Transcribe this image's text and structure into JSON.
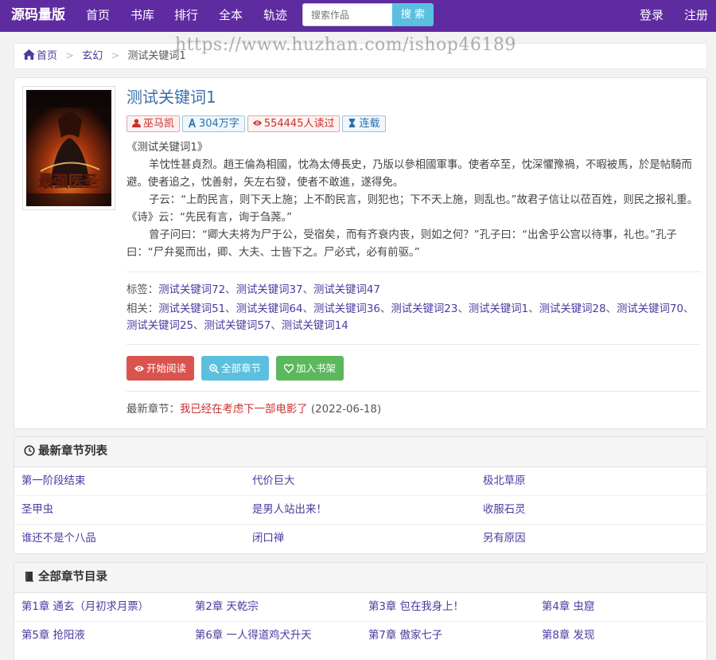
{
  "nav": {
    "brand": "源码量版",
    "links": [
      "首页",
      "书库",
      "排行",
      "全本",
      "轨迹"
    ],
    "search_placeholder": "搜索作品",
    "search_button": "搜 索",
    "login": "登录",
    "register": "注册"
  },
  "watermark": "https://www.huzhan.com/ishop46189",
  "breadcrumb": {
    "home": "首页",
    "category": "玄幻",
    "current": "测试关键词1",
    "separator": ">"
  },
  "book": {
    "title": "测试关键词1",
    "cover_text": "最强医圣",
    "author": "巫马凯",
    "words": "304万字",
    "reads": "554445人读过",
    "status": "连载",
    "intro": [
      "《测试关键词1》",
      "羊忱性甚貞烈。趙王倫為相國，忱為太傅長史，乃版以參相國軍事。使者卒至，忱深懼豫禍，不暇被馬，於是帖騎而避。使者追之，忱善射，矢左右發，使者不敢進，遂得免。",
      "子云：“上酌民言，则下天上施；上不酌民言，则犯也；下不天上施，则乱也。”故君子信让以莅百姓，则民之报礼重。《诗》云：“先民有言，询于刍荛。”",
      "曾子问曰：“卿大夫将为尸于公，受宿矣，而有齐衰内丧，则如之何？”孔子曰：“出舍乎公宫以待事，礼也。”孔子曰：“尸弁冕而出，卿、大夫、士皆下之。尸必式，必有前驱。”"
    ],
    "tags_label": "标签：",
    "tags": [
      "测试关键词72",
      "测试关键词37",
      "测试关键词47"
    ],
    "related_label": "相关：",
    "related": [
      "测试关键词51",
      "测试关键词64",
      "测试关键词36",
      "测试关键词23",
      "测试关键词1",
      "测试关键词28",
      "测试关键词70",
      "测试关键词25",
      "测试关键词57",
      "测试关键词14"
    ],
    "buttons": {
      "read": "开始阅读",
      "chapters": "全部章节",
      "shelf": "加入书架"
    },
    "latest_label": "最新章节：",
    "latest_title": "我已经在考虑下一部电影了",
    "latest_date": "(2022-06-18)"
  },
  "latest_chapters": {
    "heading": "最新章节列表",
    "rows": [
      [
        "第一阶段结束",
        "代价巨大",
        "极北草原"
      ],
      [
        "圣甲虫",
        "是男人站出来！",
        "收服石灵"
      ],
      [
        "谁还不是个八品",
        "闭口禅",
        "另有原因"
      ]
    ]
  },
  "all_chapters": {
    "heading": "全部章节目录",
    "rows": [
      [
        "第1章 通玄（月初求月票）",
        "第2章 天乾宗",
        "第3章 包在我身上！",
        "第4章 虫窟"
      ],
      [
        "第5章 抢阳液",
        "第6章 一人得道鸡犬升天",
        "第7章 傲家七子",
        "第8章 发现"
      ]
    ]
  },
  "colors": {
    "navbar": "#5e2ba0",
    "link": "#4a3aa0",
    "title": "#3a6fa8",
    "danger": "#d9534f",
    "info": "#5bc0de",
    "success": "#5cb85c"
  }
}
